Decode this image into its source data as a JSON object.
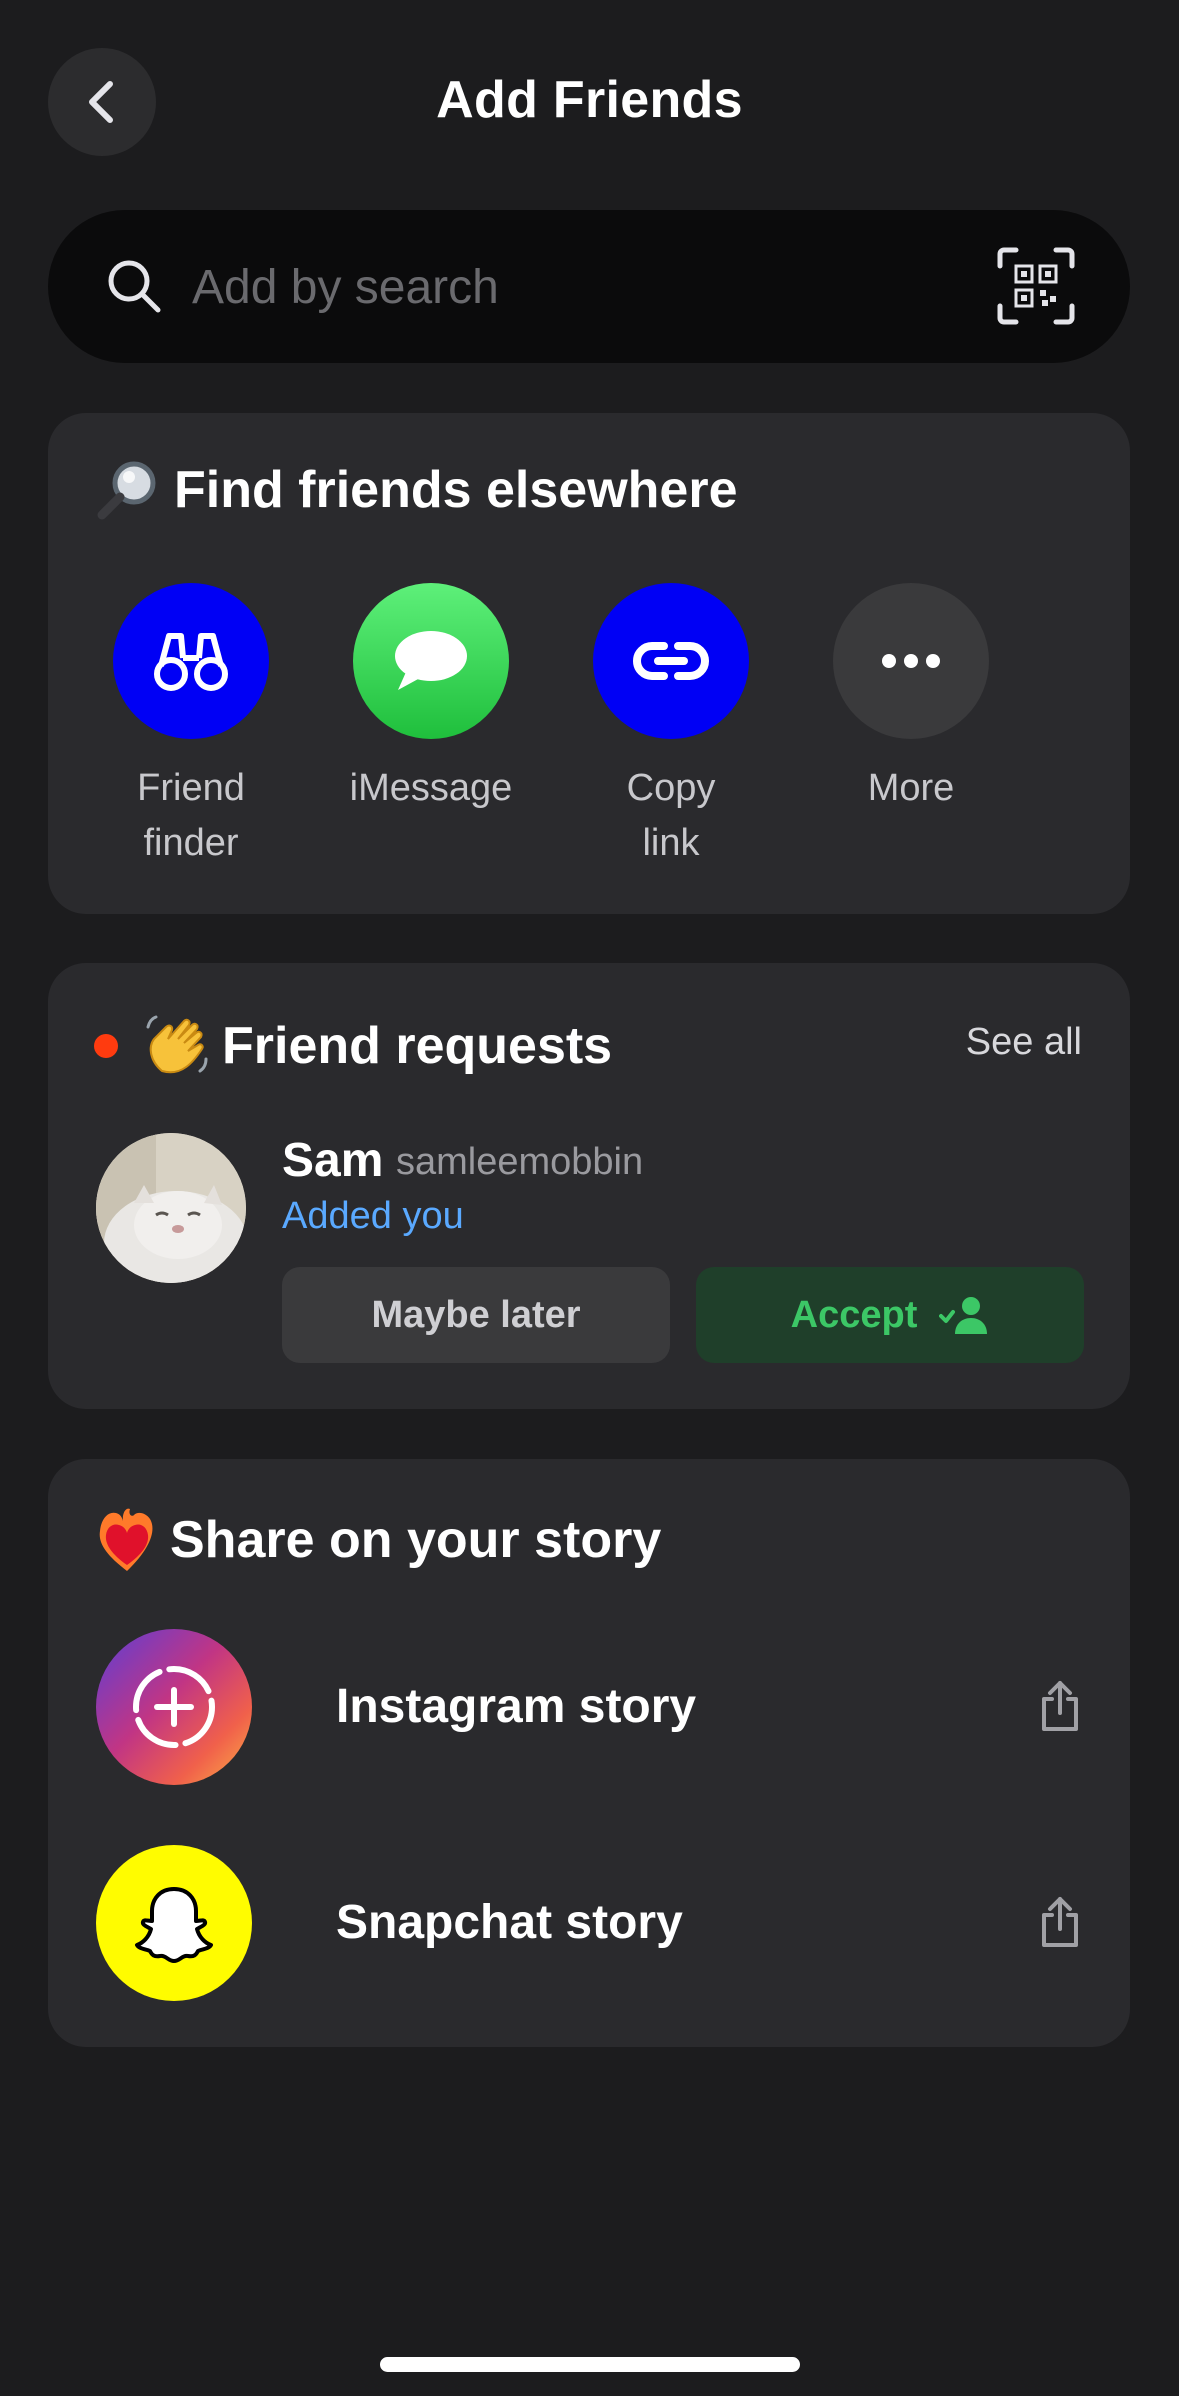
{
  "header": {
    "title": "Add Friends"
  },
  "search": {
    "placeholder": "Add by search"
  },
  "find": {
    "title": "Find friends elsewhere",
    "options": [
      {
        "label": "Friend\nfinder",
        "color": "#0000f5"
      },
      {
        "label": "iMessage",
        "color": "#2fd24a"
      },
      {
        "label": "Copy\nlink",
        "color": "#0000f5"
      },
      {
        "label": "More",
        "color": "#3a3a3c"
      }
    ]
  },
  "requests": {
    "title": "Friend requests",
    "see_all": "See all",
    "item": {
      "name": "Sam",
      "username": "samleemobbin",
      "status": "Added you",
      "maybe_label": "Maybe later",
      "accept_label": "Accept"
    }
  },
  "story": {
    "title": "Share on your story",
    "items": [
      {
        "label": "Instagram story"
      },
      {
        "label": "Snapchat story"
      }
    ]
  },
  "colors": {
    "background": "#1c1c1e",
    "card": "#2a2a2d",
    "accent_blue": "#5aa9ff",
    "accept_green": "#3cc766",
    "snapchat_yellow": "#fffc00"
  }
}
